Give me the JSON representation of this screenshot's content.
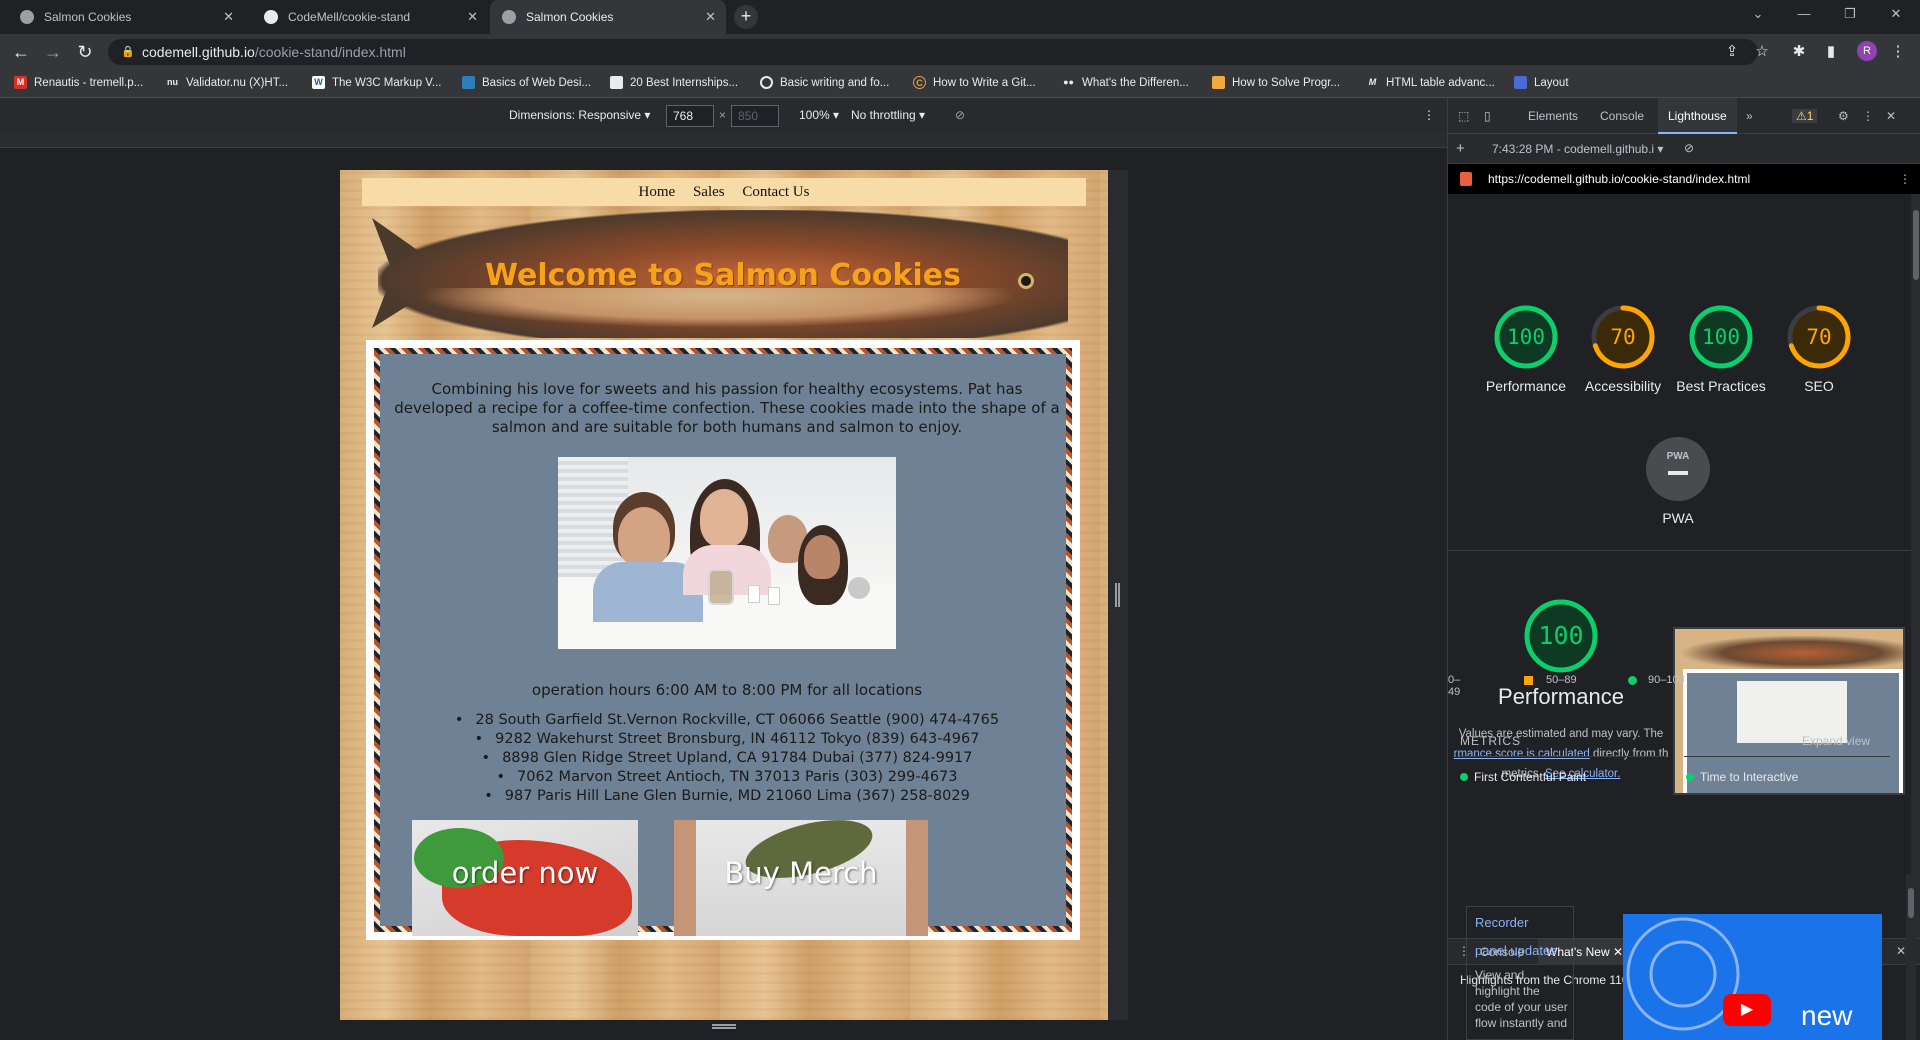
{
  "browser": {
    "tabs": [
      {
        "title": "Salmon Cookies"
      },
      {
        "title": "CodeMell/cookie-stand"
      },
      {
        "title": "Salmon Cookies"
      }
    ],
    "url_host": "codemell.github.io",
    "url_path": "/cookie-stand/index.html",
    "avatar_letter": "R",
    "bookmarks": [
      "Renautis - tremell.p...",
      "Validator.nu (X)HT...",
      "The W3C Markup V...",
      "Basics of Web Desi...",
      "20 Best Internships...",
      "Basic writing and fo...",
      "How to Write a Git...",
      "What's the Differen...",
      "How to Solve Progr...",
      "HTML table advanc...",
      "Layout"
    ]
  },
  "device_toolbar": {
    "dimensions": "Dimensions: Responsive ▾",
    "width": "768",
    "x": "×",
    "height": "850",
    "zoom": "100% ▾",
    "throttling": "No throttling ▾"
  },
  "site": {
    "nav": [
      "Home",
      "Sales",
      "Contact Us"
    ],
    "heading": "Welcome to Salmon Cookies",
    "intro": "Combining his love for sweets and his passion for healthy ecosystems. Pat has developed a recipe for a coffee-time confection. These cookies made into the shape of a salmon and are suitable for both humans and salmon to enjoy.",
    "hours": "operation hours 6:00 AM to 8:00 PM for all locations",
    "addresses": [
      "28 South Garfield St.Vernon Rockville, CT 06066 Seattle (900) 474-4765",
      "9282 Wakehurst Street Bronsburg, IN 46112 Tokyo (839) 643-4967",
      "8898 Glen Ridge Street Upland, CA 91784 Dubai (377) 824-9917",
      "7062 Marvon Street Antioch, TN 37013 Paris (303) 299-4673",
      "987 Paris Hill Lane Glen Burnie, MD 21060 Lima (367) 258-8029"
    ],
    "order_label": "order now",
    "merch_label": "Buy Merch"
  },
  "devtools": {
    "tabs": [
      "Elements",
      "Console",
      "Lighthouse"
    ],
    "warning_count": "1",
    "report_time": "7:43:28 PM - codemell.github.i ▾",
    "report_url": "https://codemell.github.io/cookie-stand/index.html",
    "scores": [
      {
        "label": "Performance",
        "value": 100,
        "color": "#0cce6b"
      },
      {
        "label": "Accessibility",
        "value": 70,
        "color": "#ffa400"
      },
      {
        "label": "Best Practices",
        "value": 100,
        "color": "#0cce6b"
      },
      {
        "label": "SEO",
        "value": 70,
        "color": "#ffa400"
      }
    ],
    "pwa_label": "PWA",
    "pwa_badge": "PWA",
    "perf_big": "100",
    "perf_title": "Performance",
    "perf_note_1": "Values are estimated and may vary. The",
    "perf_note_link": "rmance score is calculated",
    "perf_note_2": "directly from th",
    "perf_note_3": "metrics.",
    "perf_note_calc": "See calculator.",
    "legend": [
      "0–49",
      "50–89",
      "90–100"
    ],
    "metrics_title": "METRICS",
    "expand_view": "Expand view",
    "metric_1": "First Contentful Paint",
    "metric_2": "Time to Interactive",
    "drawer_tabs": [
      "Console",
      "What's New"
    ],
    "highlights": "Highlights from the Chrome 110 update",
    "recorder": "Recorder",
    "panel_updates": "panel updates",
    "recorder_desc": "View and highlight the code of your user flow instantly and",
    "video_word": "new"
  }
}
